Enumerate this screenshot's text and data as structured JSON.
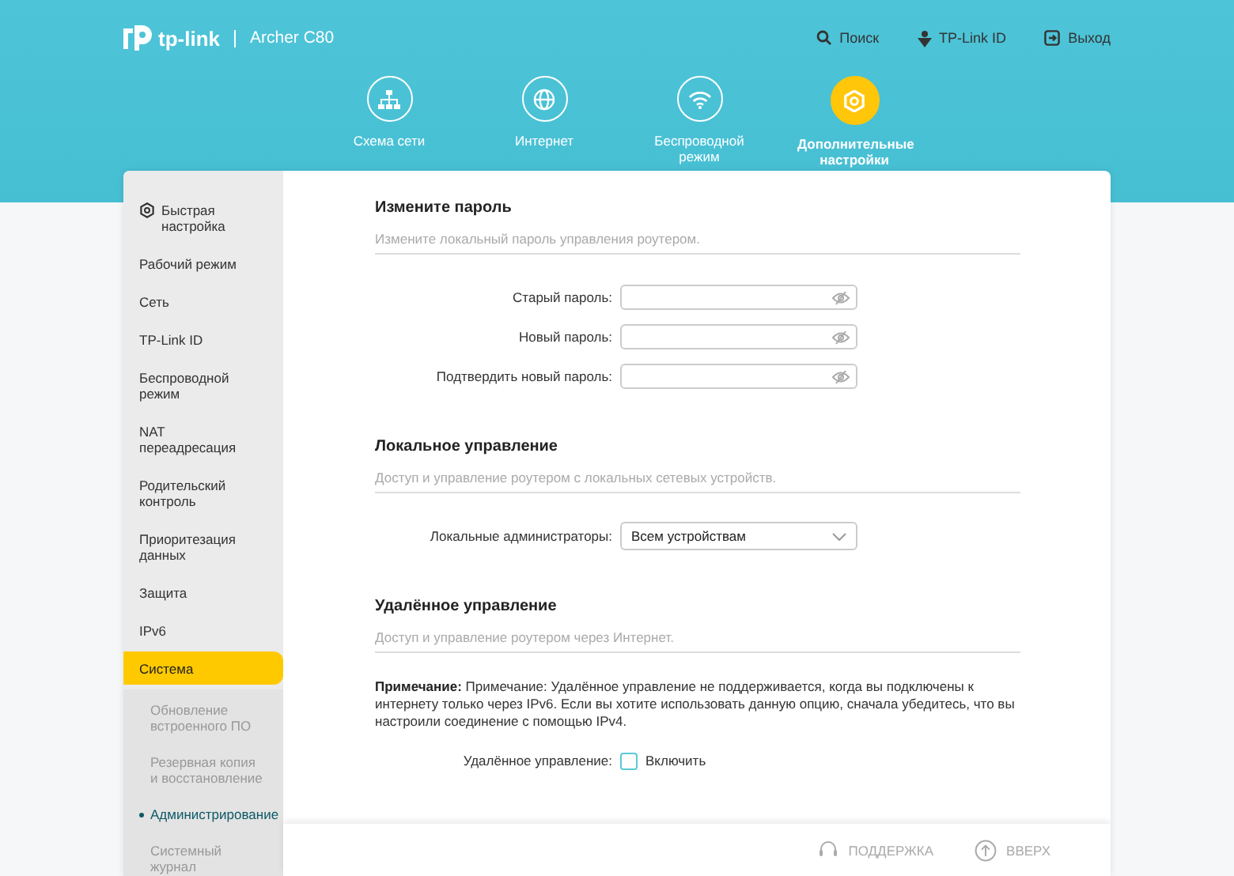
{
  "header": {
    "brand": "tp-link",
    "model": "Archer C80",
    "actions": [
      {
        "label": "Поиск",
        "kind": "search"
      },
      {
        "label": "TP-Link ID",
        "kind": "id"
      },
      {
        "label": "Выход",
        "kind": "logout"
      }
    ],
    "nav": [
      {
        "label": "Схема сети",
        "kind": "network",
        "selected": false
      },
      {
        "label": "Интернет",
        "kind": "globe",
        "selected": false
      },
      {
        "label": "Беспроводной режим",
        "kind": "wifi",
        "selected": false
      },
      {
        "label": "Дополнительные настройки",
        "kind": "gear",
        "selected": true
      }
    ]
  },
  "sidebar": {
    "items": [
      {
        "label": "Быстрая настройка",
        "kind": "gear",
        "selected": false
      },
      {
        "label": "Рабочий режим",
        "selected": false
      },
      {
        "label": "Сеть",
        "selected": false
      },
      {
        "label": "TP-Link ID",
        "selected": false
      },
      {
        "label": "Беспроводной режим",
        "selected": false
      },
      {
        "label": "NAT переадресация",
        "selected": false
      },
      {
        "label": "Родительский контроль",
        "selected": false
      },
      {
        "label": "Приоритезация данных",
        "selected": false
      },
      {
        "label": "Защита",
        "selected": false
      },
      {
        "label": "IPv6",
        "selected": false
      },
      {
        "label": "Система",
        "selected": true,
        "children": [
          {
            "label": "Обновление встроенного ПО",
            "selected": false
          },
          {
            "label": "Резервная копия и восстановление",
            "selected": false
          },
          {
            "label": "Администрирование",
            "selected": true
          },
          {
            "label": "Системный журнал",
            "selected": false
          }
        ]
      }
    ]
  },
  "sections": [
    {
      "title": "Измените пароль",
      "description": "Измените локальный пароль управления роутером.",
      "rows": [
        {
          "kind": "password",
          "label": "Старый пароль:"
        },
        {
          "kind": "password",
          "label": "Новый пароль:"
        },
        {
          "kind": "password",
          "label": "Подтвердить новый пароль:"
        }
      ]
    },
    {
      "title": "Локальное управление",
      "description": "Доступ и управление роутером с локальных сетевых устройств.",
      "rows": [
        {
          "kind": "select",
          "label": "Локальные администраторы:",
          "value": "Всем устройствам"
        }
      ]
    },
    {
      "title": "Удалённое управление",
      "description": "Доступ и управление роутером через Интернет.",
      "note": "**Примечание:** Примечание: Удалённое управление не поддерживается, когда вы подключены к интернету только через IPv6. Если вы хотите использовать данную опцию, сначала убедитесь, что вы настроили соединение с помощью IPv4.",
      "rows": [
        {
          "kind": "checkbox",
          "label": "Удалённое управление:",
          "option": "Включить",
          "checked": false
        }
      ]
    }
  ],
  "footer": {
    "buttons": [
      {
        "label": "ПОДДЕРЖКА",
        "kind": "support"
      },
      {
        "label": "ВВЕРХ",
        "kind": "up"
      }
    ]
  }
}
